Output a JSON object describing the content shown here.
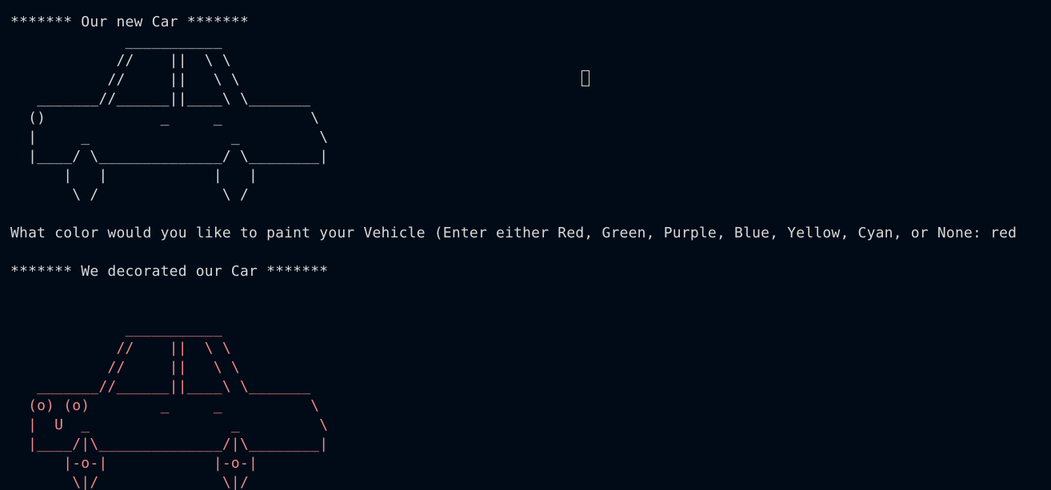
{
  "terminal": {
    "heading_new_car": "******* Our new Car *******",
    "car_plain_ascii": "             ___________\n            //    ||  \\ \\\n           //     ||   \\ \\\n   _______//______||____\\ \\_______\n  ()             _     _          \\\n  |     _                _         \\\n  |____/ \\______________/ \\________|\n      |   |            |   |\n       \\ /              \\ /",
    "prompt_text": "What color would you like to paint your Vehicle (Enter either Red, Green, Purple, Blue, Yellow, Cyan, or None: ",
    "user_answer": "red",
    "heading_decorated": "******* We decorated our Car *******",
    "car_decorated_ascii": "\n             ___________\n            //    ||  \\ \\\n           //     ||   \\ \\\n   _______//______||____\\ \\_______\n  (o) (o)        _     _          \\\n  |  U  _                _         \\\n  |____/|\\______________/|\\________|\n      |-o-|            |-o-|\n       \\|/              \\|/"
  },
  "colors": {
    "background": "#010b17",
    "text": "#d8d8d8",
    "car_decorated": "#f08a8a"
  }
}
